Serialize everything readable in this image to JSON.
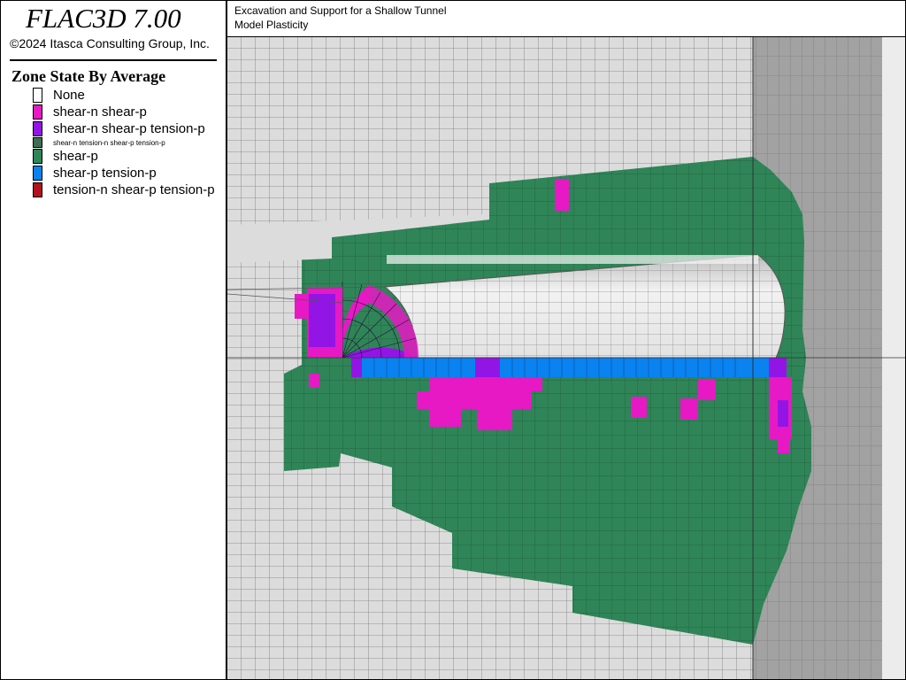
{
  "app": {
    "title": "FLAC3D 7.00",
    "copyright": "©2024 Itasca Consulting Group, Inc."
  },
  "legend": {
    "title": "Zone State By Average",
    "items": [
      {
        "label": "None",
        "color": "#ffffff",
        "size": "normal"
      },
      {
        "label": "shear-n shear-p",
        "color": "#e619c4",
        "size": "normal"
      },
      {
        "label": "shear-n shear-p tension-p",
        "color": "#9315e6",
        "size": "normal"
      },
      {
        "label": "shear-n tension-n shear-p tension-p",
        "color": "#3f6e55",
        "size": "small"
      },
      {
        "label": "shear-p",
        "color": "#2f8557",
        "size": "normal"
      },
      {
        "label": "shear-p tension-p",
        "color": "#0a82f0",
        "size": "normal"
      },
      {
        "label": "tension-n shear-p tension-p",
        "color": "#b3111d",
        "size": "normal"
      }
    ]
  },
  "model": {
    "title": "Excavation and Support for a Shallow Tunnel",
    "subtitle": "Model Plasticity"
  }
}
